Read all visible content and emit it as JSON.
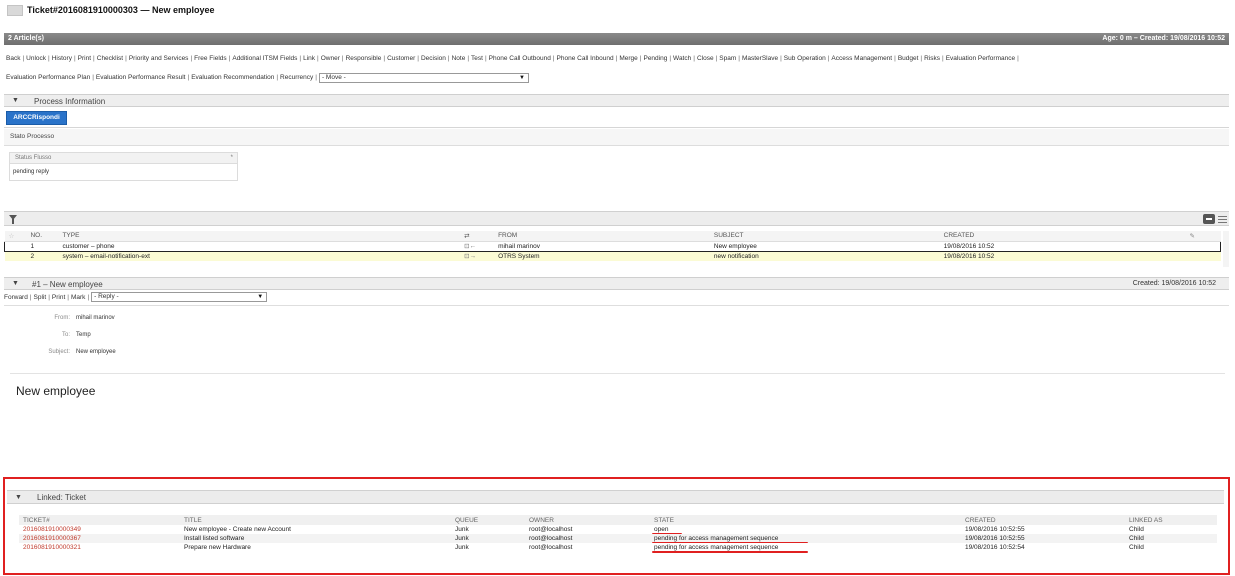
{
  "window": {
    "title": "Ticket#2016081910000303 — New employee"
  },
  "article_bar": {
    "count": "2 Article(s)",
    "age_created": "Age: 0 m – Created: 19/08/2016 10:52"
  },
  "action_menu": {
    "row1": [
      "Back",
      "Unlock",
      "History",
      "Print",
      "Checklist",
      "Priority and Services",
      "Free Fields",
      "Additional ITSM Fields",
      "Link",
      "Owner",
      "Responsible",
      "Customer",
      "Decision",
      "Note",
      "Test",
      "Phone Call Outbound",
      "Phone Call Inbound",
      "Merge",
      "Pending",
      "Watch",
      "Close",
      "Spam",
      "MasterSlave",
      "Sub Operation",
      "Access Management",
      "Budget",
      "Risks",
      "Evaluation Performance"
    ],
    "row2": [
      "Evaluation Performance Plan",
      "Evaluation Performance Result",
      "Evaluation Recommendation",
      "Recurrency"
    ],
    "move_select": "- Move -"
  },
  "process": {
    "title": "Process Information",
    "button": "ARCCRispondi",
    "stato": "Stato Processo",
    "status_label": "Status Flusso",
    "status_value": "pending reply"
  },
  "articles": {
    "columns": [
      "NO.",
      "TYPE",
      "FROM",
      "SUBJECT",
      "CREATED"
    ],
    "rows": [
      {
        "no": "1",
        "type": "customer – phone",
        "from": "mihail marinov",
        "subject": "New employee",
        "created": "19/08/2016 10:52"
      },
      {
        "no": "2",
        "type": "system – email-notification-ext",
        "from": "OTRS System",
        "subject": "new notification",
        "created": "19/08/2016 10:52"
      }
    ]
  },
  "article_detail": {
    "title": "#1 – New employee",
    "created": "Created: 19/08/2016 10:52",
    "actions": [
      "Forward",
      "Split",
      "Print",
      "Mark"
    ],
    "reply_select": "- Reply -",
    "from_label": "From:",
    "from_value": "mihail marinov",
    "to_label": "To:",
    "to_value": "Temp",
    "subject_label": "Subject:",
    "subject_value": "New employee",
    "body": "New employee"
  },
  "linked": {
    "title": "Linked: Ticket",
    "columns": [
      "TICKET#",
      "TITLE",
      "QUEUE",
      "OWNER",
      "STATE",
      "CREATED",
      "LINKED AS"
    ],
    "rows": [
      {
        "ticket": "2016081910000349",
        "title": "New employee - Create new Account",
        "queue": "Junk",
        "owner": "root@localhost",
        "state": "open",
        "created": "19/08/2016 10:52:55",
        "linked_as": "Child"
      },
      {
        "ticket": "2016081910000367",
        "title": "Install listed software",
        "queue": "Junk",
        "owner": "root@localhost",
        "state": "pending for access management sequence",
        "created": "19/08/2016 10:52:55",
        "linked_as": "Child"
      },
      {
        "ticket": "2016081910000321",
        "title": "Prepare new Hardware",
        "queue": "Junk",
        "owner": "root@localhost",
        "state": "pending for access management sequence",
        "created": "19/08/2016 10:52:54",
        "linked_as": "Child"
      }
    ]
  },
  "colors": {
    "highlight": "#e02020",
    "ticket_link": "#c0392b",
    "process_button": "#2a73c9"
  }
}
